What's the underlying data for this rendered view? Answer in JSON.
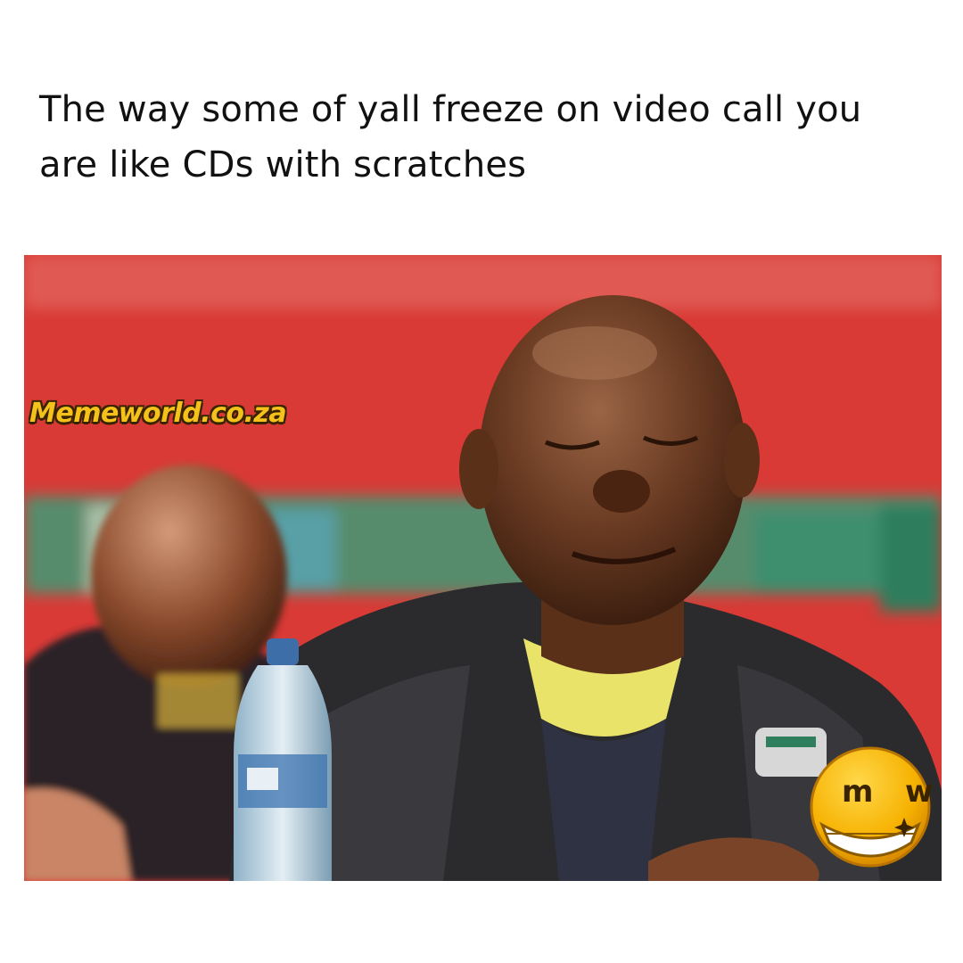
{
  "caption": {
    "line1": "The way some of yall freeze on video call you",
    "line2": "are like CDs with scratches"
  },
  "photo": {
    "watermark": "Memeworld.co.za",
    "logo_letters": "m w",
    "colors": {
      "backdrop": "#d93a36",
      "banner_green": "#3f9a76",
      "jacket": "#2b2b2e",
      "skin": "#6a3b22",
      "shirt_yellow": "#e9e36a",
      "logo_yellow": "#f6b100"
    }
  }
}
